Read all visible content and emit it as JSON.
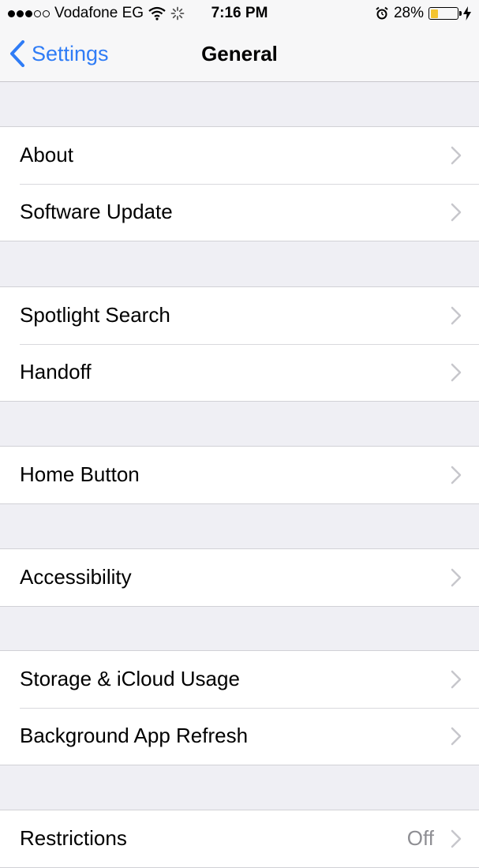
{
  "status_bar": {
    "carrier": "Vodafone EG",
    "time": "7:16 PM",
    "battery_percent": "28%",
    "battery_level": 0.28,
    "signal_bars_filled": 3,
    "signal_bars_total": 5
  },
  "nav": {
    "back_label": "Settings",
    "title": "General"
  },
  "groups": [
    {
      "rows": [
        {
          "label": "About"
        },
        {
          "label": "Software Update"
        }
      ]
    },
    {
      "rows": [
        {
          "label": "Spotlight Search"
        },
        {
          "label": "Handoff"
        }
      ]
    },
    {
      "rows": [
        {
          "label": "Home Button"
        }
      ]
    },
    {
      "rows": [
        {
          "label": "Accessibility"
        }
      ]
    },
    {
      "rows": [
        {
          "label": "Storage & iCloud Usage"
        },
        {
          "label": "Background App Refresh"
        }
      ]
    },
    {
      "rows": [
        {
          "label": "Restrictions",
          "value": "Off"
        }
      ]
    }
  ],
  "colors": {
    "accent": "#2f7cf6",
    "background": "#efeff4",
    "battery_fill": "#f4c430"
  },
  "icons": [
    "wifi-icon",
    "activity-spinner-icon",
    "alarm-icon",
    "battery-icon",
    "charging-bolt-icon",
    "chevron-left-icon",
    "chevron-right-icon"
  ]
}
